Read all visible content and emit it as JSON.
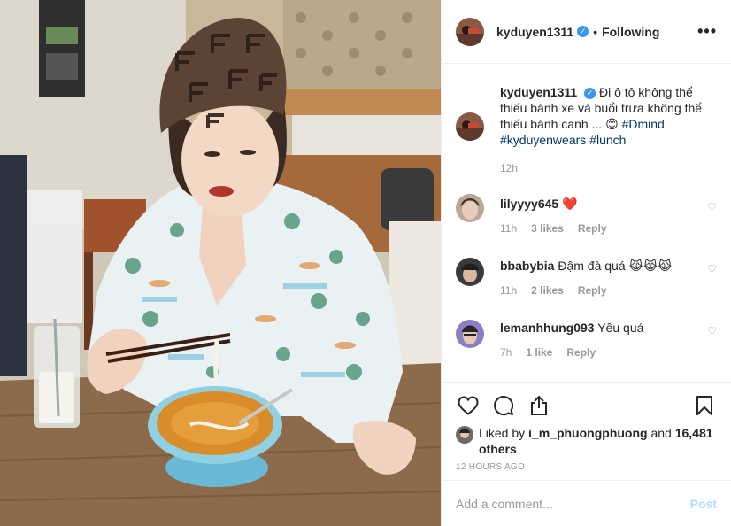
{
  "post": {
    "author": "kyduyen1311",
    "follow_status": "Following",
    "dot": "•",
    "more": "•••"
  },
  "caption": {
    "username": "kyduyen1311",
    "text": "Đi ô tô không thể thiếu bánh xe và buổi trưa không thể thiếu bánh canh ... 😊",
    "tags": [
      "#Dmind",
      "#kyduyenwears",
      "#lunch"
    ],
    "time": "12h"
  },
  "comments": [
    {
      "username": "lilyyyy645",
      "text": "❤️",
      "time": "11h",
      "likes": "3 likes",
      "reply": "Reply"
    },
    {
      "username": "bbabybia",
      "text": "Đậm đà quá 😹😹😹",
      "time": "11h",
      "likes": "2 likes",
      "reply": "Reply"
    },
    {
      "username": "lemanhhung093",
      "text": "Yêu quá",
      "time": "7h",
      "likes": "1 like",
      "reply": "Reply"
    }
  ],
  "likes": {
    "prefix": "Liked by",
    "user": "i_m_phuongphuong",
    "and": "and",
    "others": "16,481 others"
  },
  "timestamp": "12 HOURS AGO",
  "add_comment": {
    "placeholder": "Add a comment...",
    "post_label": "Post"
  },
  "icons": {
    "verified": "✓",
    "heart_small": "♡",
    "like": "heart-icon",
    "comment": "comment-icon",
    "share": "share-icon",
    "save": "bookmark-icon"
  },
  "colors": {
    "link": "#003569",
    "verified": "#3897f0",
    "post_disabled": "#b2dffc",
    "meta": "#999999"
  }
}
